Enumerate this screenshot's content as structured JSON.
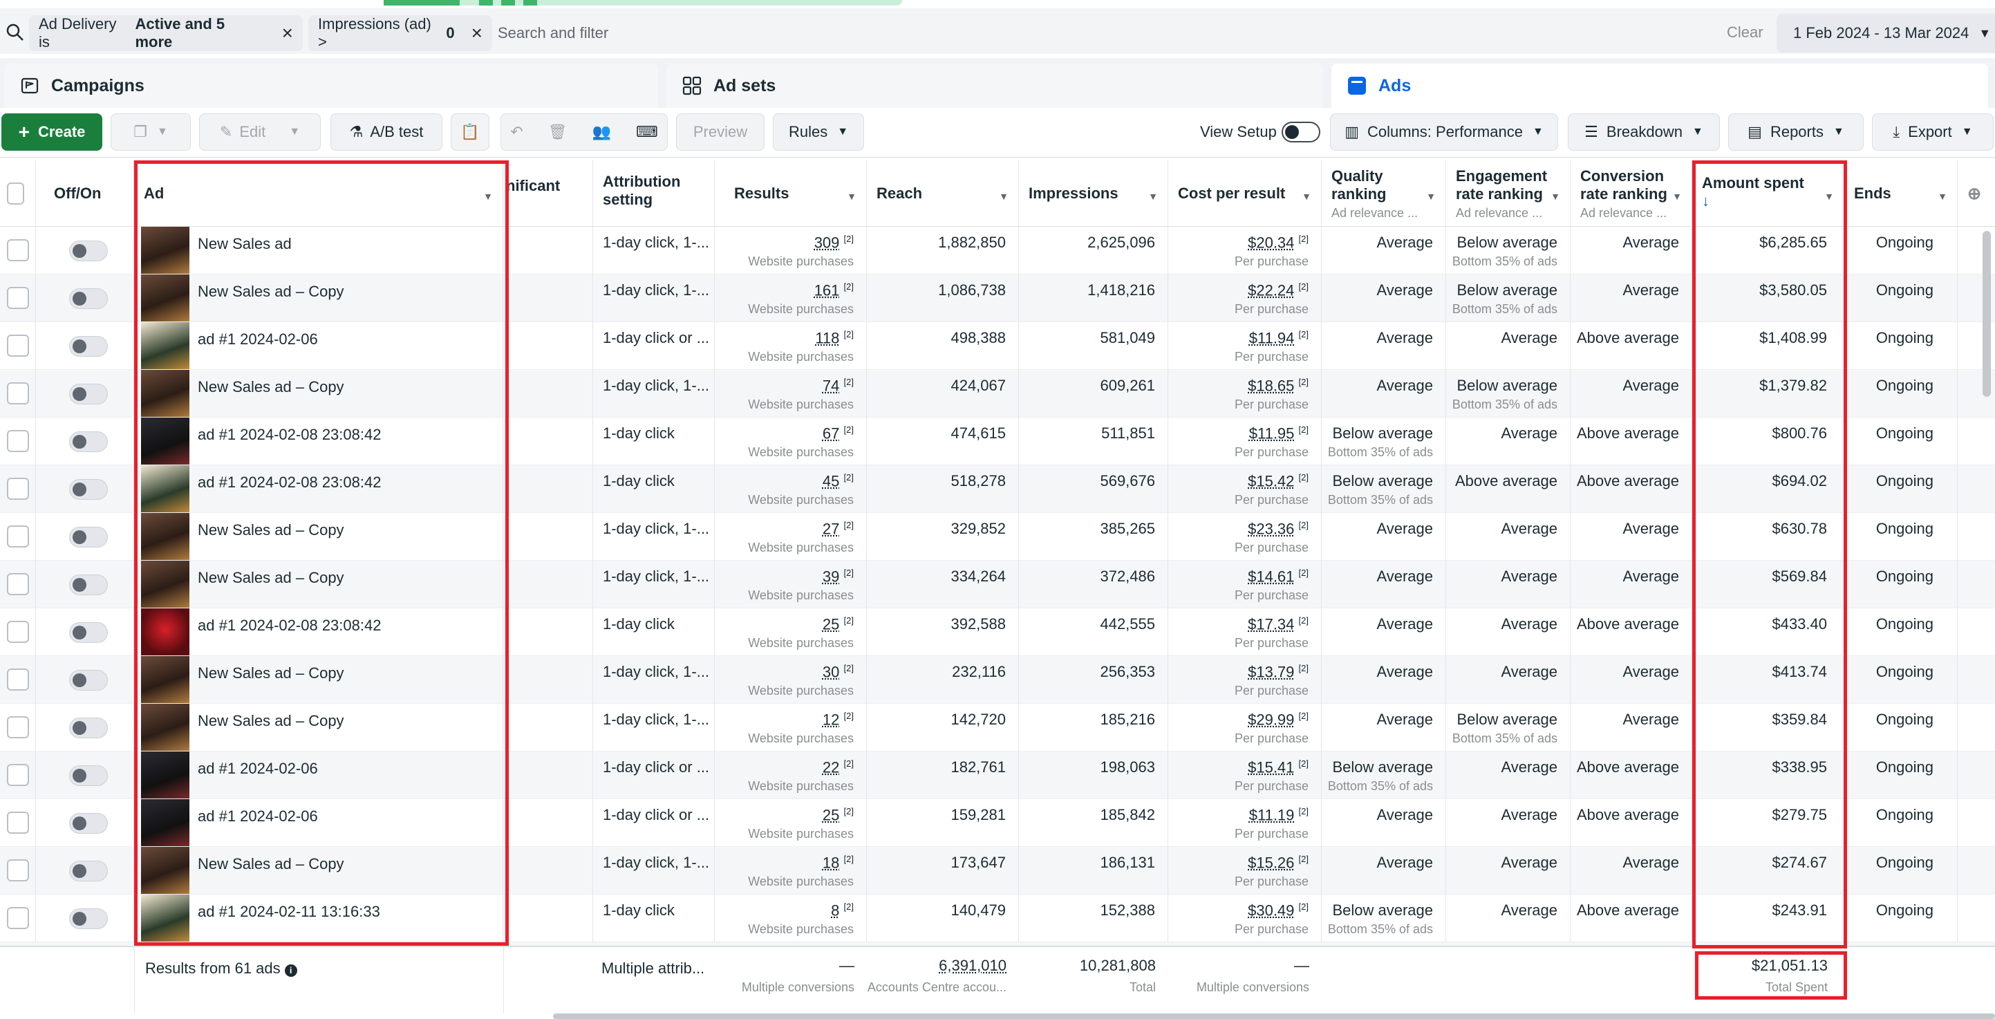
{
  "filters": {
    "chips": [
      {
        "prefix": "Ad Delivery is",
        "bold": "Active and 5 more"
      },
      {
        "prefix": "Impressions (ad) >",
        "bold": "0"
      }
    ],
    "search_placeholder": "Search and filter",
    "clear_label": "Clear",
    "date_range": "1 Feb 2024 - 13 Mar 2024"
  },
  "level_tabs": [
    {
      "label": "Campaigns",
      "active": false
    },
    {
      "label": "Ad sets",
      "active": false
    },
    {
      "label": "Ads",
      "active": true
    }
  ],
  "toolbar": {
    "create_label": "Create",
    "edit_label": "Edit",
    "ab_test_label": "A/B test",
    "preview_label": "Preview",
    "rules_label": "Rules",
    "view_setup_label": "View Setup",
    "columns_label": "Columns: Performance",
    "breakdown_label": "Breakdown",
    "reports_label": "Reports",
    "export_label": "Export"
  },
  "columns": {
    "off_on": "Off/On",
    "ad": "Ad",
    "significant": "nificant",
    "attribution": "Attribution setting",
    "results": "Results",
    "reach": "Reach",
    "impressions": "Impressions",
    "cost_per_result": "Cost per result",
    "quality": "Quality ranking",
    "quality_sub": "Ad relevance ...",
    "engagement": "Engagement rate ranking",
    "engagement_sub": "Ad relevance ...",
    "conversion": "Conversion rate ranking",
    "conversion_sub": "Ad relevance ...",
    "amount_spent": "Amount spent",
    "ends": "Ends"
  },
  "rows": [
    {
      "name": "New Sales ad",
      "thumb": "",
      "attr": "1-day click, 1-...",
      "results": "309",
      "results_sub": "Website purchases",
      "reach": "1,882,850",
      "impr": "2,625,096",
      "cpr": "$20.34",
      "cpr_sub": "Per purchase",
      "quality": "Average",
      "quality_sub": "",
      "engagement": "Below average",
      "engagement_sub": "Bottom 35% of ads",
      "conversion": "Average",
      "spent": "$6,285.65",
      "ends": "Ongoing"
    },
    {
      "name": "New Sales ad – Copy",
      "thumb": "",
      "attr": "1-day click, 1-...",
      "results": "161",
      "results_sub": "Website purchases",
      "reach": "1,086,738",
      "impr": "1,418,216",
      "cpr": "$22.24",
      "cpr_sub": "Per purchase",
      "quality": "Average",
      "quality_sub": "",
      "engagement": "Below average",
      "engagement_sub": "Bottom 35% of ads",
      "conversion": "Average",
      "spent": "$3,580.05",
      "ends": "Ongoing"
    },
    {
      "name": "ad #1 2024-02-06",
      "thumb": "green",
      "attr": "1-day click or ...",
      "results": "118",
      "results_sub": "Website purchases",
      "reach": "498,388",
      "impr": "581,049",
      "cpr": "$11.94",
      "cpr_sub": "Per purchase",
      "quality": "Average",
      "quality_sub": "",
      "engagement": "Average",
      "engagement_sub": "",
      "conversion": "Above average",
      "spent": "$1,408.99",
      "ends": "Ongoing"
    },
    {
      "name": "New Sales ad – Copy",
      "thumb": "",
      "attr": "1-day click, 1-...",
      "results": "74",
      "results_sub": "Website purchases",
      "reach": "424,067",
      "impr": "609,261",
      "cpr": "$18.65",
      "cpr_sub": "Per purchase",
      "quality": "Average",
      "quality_sub": "",
      "engagement": "Below average",
      "engagement_sub": "Bottom 35% of ads",
      "conversion": "Average",
      "spent": "$1,379.82",
      "ends": "Ongoing"
    },
    {
      "name": "ad #1 2024-02-08 23:08:42",
      "thumb": "dark",
      "attr": "1-day click",
      "results": "67",
      "results_sub": "Website purchases",
      "reach": "474,615",
      "impr": "511,851",
      "cpr": "$11.95",
      "cpr_sub": "Per purchase",
      "quality": "Below average",
      "quality_sub": "Bottom 35% of ads",
      "engagement": "Average",
      "engagement_sub": "",
      "conversion": "Above average",
      "spent": "$800.76",
      "ends": "Ongoing"
    },
    {
      "name": "ad #1 2024-02-08 23:08:42",
      "thumb": "green",
      "attr": "1-day click",
      "results": "45",
      "results_sub": "Website purchases",
      "reach": "518,278",
      "impr": "569,676",
      "cpr": "$15.42",
      "cpr_sub": "Per purchase",
      "quality": "Below average",
      "quality_sub": "Bottom 35% of ads",
      "engagement": "Above average",
      "engagement_sub": "",
      "conversion": "Above average",
      "spent": "$694.02",
      "ends": "Ongoing"
    },
    {
      "name": "New Sales ad – Copy",
      "thumb": "",
      "attr": "1-day click, 1-...",
      "results": "27",
      "results_sub": "Website purchases",
      "reach": "329,852",
      "impr": "385,265",
      "cpr": "$23.36",
      "cpr_sub": "Per purchase",
      "quality": "Average",
      "quality_sub": "",
      "engagement": "Average",
      "engagement_sub": "",
      "conversion": "Average",
      "spent": "$630.78",
      "ends": "Ongoing"
    },
    {
      "name": "New Sales ad – Copy",
      "thumb": "",
      "attr": "1-day click, 1-...",
      "results": "39",
      "results_sub": "Website purchases",
      "reach": "334,264",
      "impr": "372,486",
      "cpr": "$14.61",
      "cpr_sub": "Per purchase",
      "quality": "Average",
      "quality_sub": "",
      "engagement": "Average",
      "engagement_sub": "",
      "conversion": "Average",
      "spent": "$569.84",
      "ends": "Ongoing"
    },
    {
      "name": "ad #1 2024-02-08 23:08:42",
      "thumb": "red",
      "attr": "1-day click",
      "results": "25",
      "results_sub": "Website purchases",
      "reach": "392,588",
      "impr": "442,555",
      "cpr": "$17.34",
      "cpr_sub": "Per purchase",
      "quality": "Average",
      "quality_sub": "",
      "engagement": "Average",
      "engagement_sub": "",
      "conversion": "Above average",
      "spent": "$433.40",
      "ends": "Ongoing"
    },
    {
      "name": "New Sales ad – Copy",
      "thumb": "",
      "attr": "1-day click, 1-...",
      "results": "30",
      "results_sub": "Website purchases",
      "reach": "232,116",
      "impr": "256,353",
      "cpr": "$13.79",
      "cpr_sub": "Per purchase",
      "quality": "Average",
      "quality_sub": "",
      "engagement": "Average",
      "engagement_sub": "",
      "conversion": "Average",
      "spent": "$413.74",
      "ends": "Ongoing"
    },
    {
      "name": "New Sales ad – Copy",
      "thumb": "",
      "attr": "1-day click, 1-...",
      "results": "12",
      "results_sub": "Website purchases",
      "reach": "142,720",
      "impr": "185,216",
      "cpr": "$29.99",
      "cpr_sub": "Per purchase",
      "quality": "Average",
      "quality_sub": "",
      "engagement": "Below average",
      "engagement_sub": "Bottom 35% of ads",
      "conversion": "Average",
      "spent": "$359.84",
      "ends": "Ongoing"
    },
    {
      "name": "ad #1 2024-02-06",
      "thumb": "dark",
      "attr": "1-day click or ...",
      "results": "22",
      "results_sub": "Website purchases",
      "reach": "182,761",
      "impr": "198,063",
      "cpr": "$15.41",
      "cpr_sub": "Per purchase",
      "quality": "Below average",
      "quality_sub": "Bottom 35% of ads",
      "engagement": "Average",
      "engagement_sub": "",
      "conversion": "Above average",
      "spent": "$338.95",
      "ends": "Ongoing"
    },
    {
      "name": "ad #1 2024-02-06",
      "thumb": "dark",
      "attr": "1-day click or ...",
      "results": "25",
      "results_sub": "Website purchases",
      "reach": "159,281",
      "impr": "185,842",
      "cpr": "$11.19",
      "cpr_sub": "Per purchase",
      "quality": "Average",
      "quality_sub": "",
      "engagement": "Average",
      "engagement_sub": "",
      "conversion": "Above average",
      "spent": "$279.75",
      "ends": "Ongoing"
    },
    {
      "name": "New Sales ad – Copy",
      "thumb": "",
      "attr": "1-day click, 1-...",
      "results": "18",
      "results_sub": "Website purchases",
      "reach": "173,647",
      "impr": "186,131",
      "cpr": "$15.26",
      "cpr_sub": "Per purchase",
      "quality": "Average",
      "quality_sub": "",
      "engagement": "Average",
      "engagement_sub": "",
      "conversion": "Average",
      "spent": "$274.67",
      "ends": "Ongoing"
    },
    {
      "name": "ad #1 2024-02-11 13:16:33",
      "thumb": "green",
      "attr": "1-day click",
      "results": "8",
      "results_sub": "Website purchases",
      "reach": "140,479",
      "impr": "152,388",
      "cpr": "$30.49",
      "cpr_sub": "Per purchase",
      "quality": "Below average",
      "quality_sub": "Bottom 35% of ads",
      "engagement": "Average",
      "engagement_sub": "",
      "conversion": "Above average",
      "spent": "$243.91",
      "ends": "Ongoing"
    }
  ],
  "footer": {
    "results_from": "Results from 61 ads",
    "attr": "Multiple attrib...",
    "results": "—",
    "results_sub": "Multiple conversions",
    "reach": "6,391,010",
    "reach_sub": "Accounts Centre accou...",
    "impr": "10,281,808",
    "impr_sub": "Total",
    "cpr": "—",
    "cpr_sub": "Multiple conversions",
    "spent": "$21,051.13",
    "spent_sub": "Total Spent"
  },
  "colors": {
    "create_green": "#1a7f3c",
    "active_tab_blue": "#0a66e4",
    "highlight_red": "#e8202a"
  }
}
